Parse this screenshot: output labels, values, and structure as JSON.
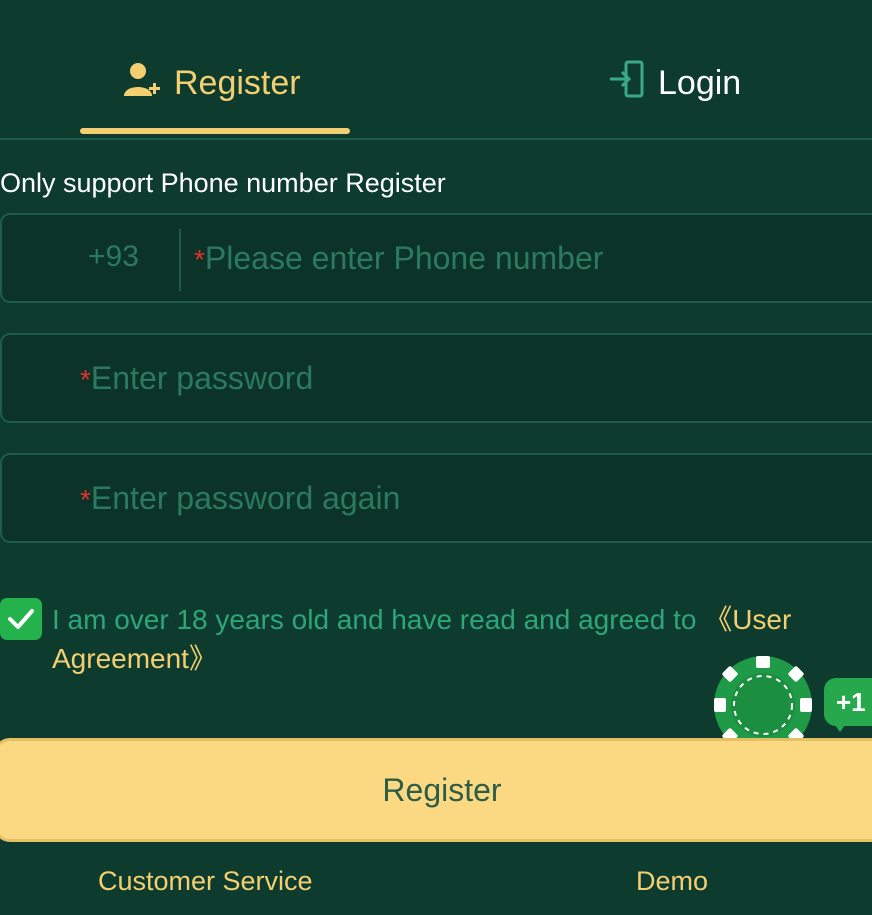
{
  "tabs": {
    "register_label": "Register",
    "login_label": "Login",
    "register_icon": "add-user-icon",
    "login_icon": "login-door-icon"
  },
  "form": {
    "subtitle": "Only support Phone number Register",
    "phone_prefix": "+93",
    "required_mark": "*",
    "phone_placeholder": "Please enter Phone number",
    "password_placeholder": "Enter password",
    "password_again_placeholder": "Enter password again"
  },
  "agreement": {
    "checked": true,
    "text": "I am over 18 years old and have read and agreed to ",
    "link": "《User Agreement》"
  },
  "badge": {
    "chip_icon": "poker-chip-icon",
    "bubble_text": "+1"
  },
  "actions": {
    "register_button": "Register",
    "customer_service": "Customer Service",
    "demo": "Demo"
  },
  "colors": {
    "background": "#0d3b2e",
    "accent_gold": "#f3cf71",
    "button_fill": "#fbd982",
    "check_green": "#23b24b",
    "placeholder_green": "#2c7a5e",
    "required_red": "#e0312e"
  }
}
